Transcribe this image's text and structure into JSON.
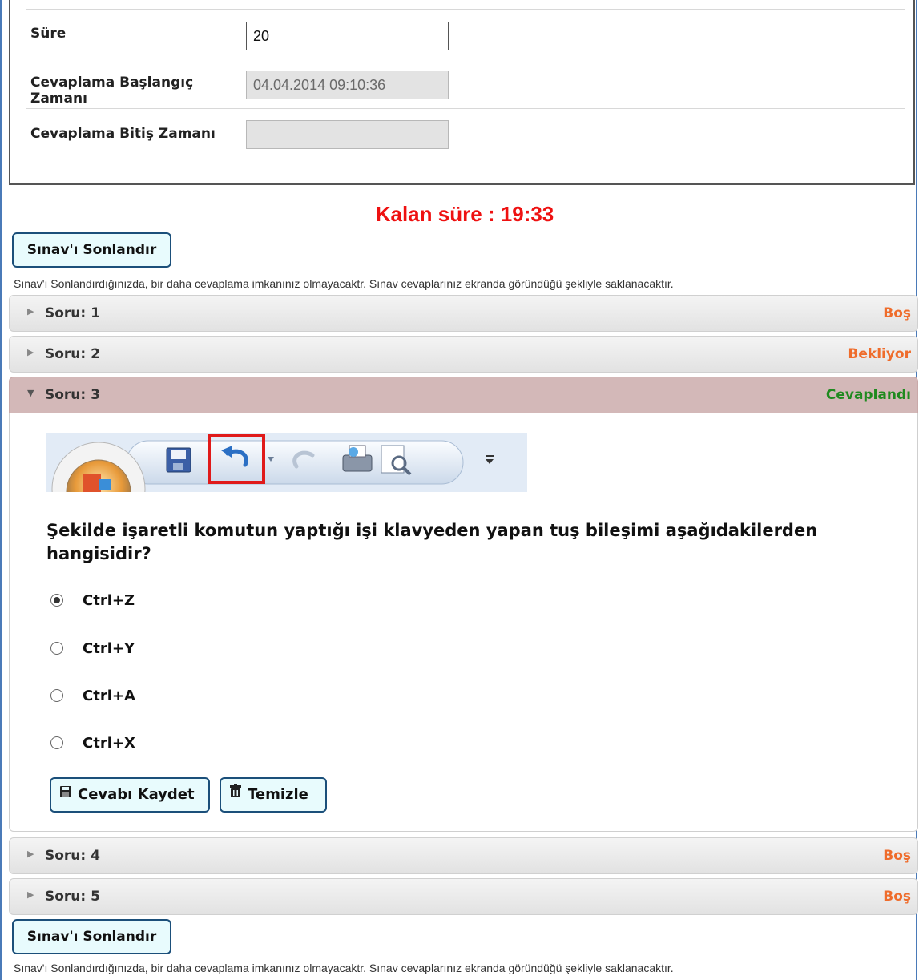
{
  "info": {
    "duration_label": "Süre",
    "duration_value": "20",
    "start_label": "Cevaplama Başlangıç Zamanı",
    "start_value": "04.04.2014 09:10:36",
    "end_label": "Cevaplama Bitiş Zamanı",
    "end_value": ""
  },
  "timer": "Kalan süre : 19:33",
  "end_exam_label": "Sınav'ı Sonlandır",
  "notice": "Sınav'ı Sonlandırdığınızda, bir daha cevaplama imkanınız olmayacaktr. Sınav cevaplarınız ekranda göründüğü şekliyle saklanacaktır.",
  "questions": [
    {
      "title": "Soru: 1",
      "status": "Boş"
    },
    {
      "title": "Soru: 2",
      "status": "Bekliyor"
    },
    {
      "title": "Soru: 3",
      "status": "Cevaplandı"
    },
    {
      "title": "Soru: 4",
      "status": "Boş"
    },
    {
      "title": "Soru: 5",
      "status": "Boş"
    }
  ],
  "open_question": {
    "text": "Şekilde işaretli komutun yaptığı işi klavyeden yapan tuş bileşimi aşağıdakilerden hangisidir?",
    "options": [
      "Ctrl+Z",
      "Ctrl+Y",
      "Ctrl+A",
      "Ctrl+X"
    ],
    "selected": "Ctrl+Z",
    "save_label": "Cevabı Kaydet",
    "clear_label": "Temizle"
  },
  "colors": {
    "timer": "#ee1111",
    "status_empty": "#ef6c2b",
    "status_done": "#1f8a1f",
    "open_header": "#d3b8b8",
    "button_bg": "#e8fbfd",
    "button_border": "#1b4f7a"
  }
}
